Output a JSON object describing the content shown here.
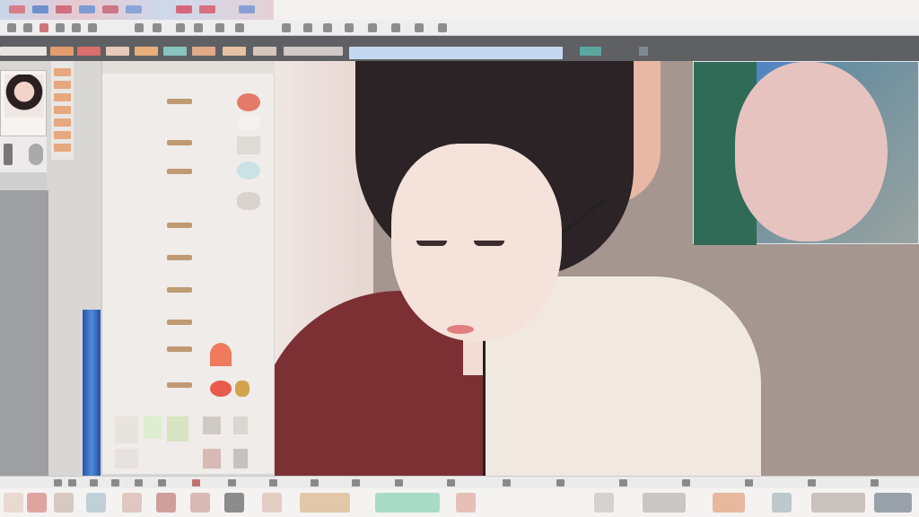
{
  "window": {
    "title": ""
  },
  "colors": {
    "menubar": "#f3f2f0",
    "tabbar": "#5f6063",
    "active_tab": "#c5d8f2",
    "panel": "#efece9",
    "canvas_bg": "#a69690",
    "accent_blue": "#4d8bdb",
    "brush_tag": "#bf9a72"
  },
  "icons": [
    "menu-icon",
    "brush-icon",
    "eraser-icon",
    "layer-icon",
    "zoom-icon",
    "rotate-icon",
    "color-wheel-icon",
    "thumbnail-icon"
  ]
}
